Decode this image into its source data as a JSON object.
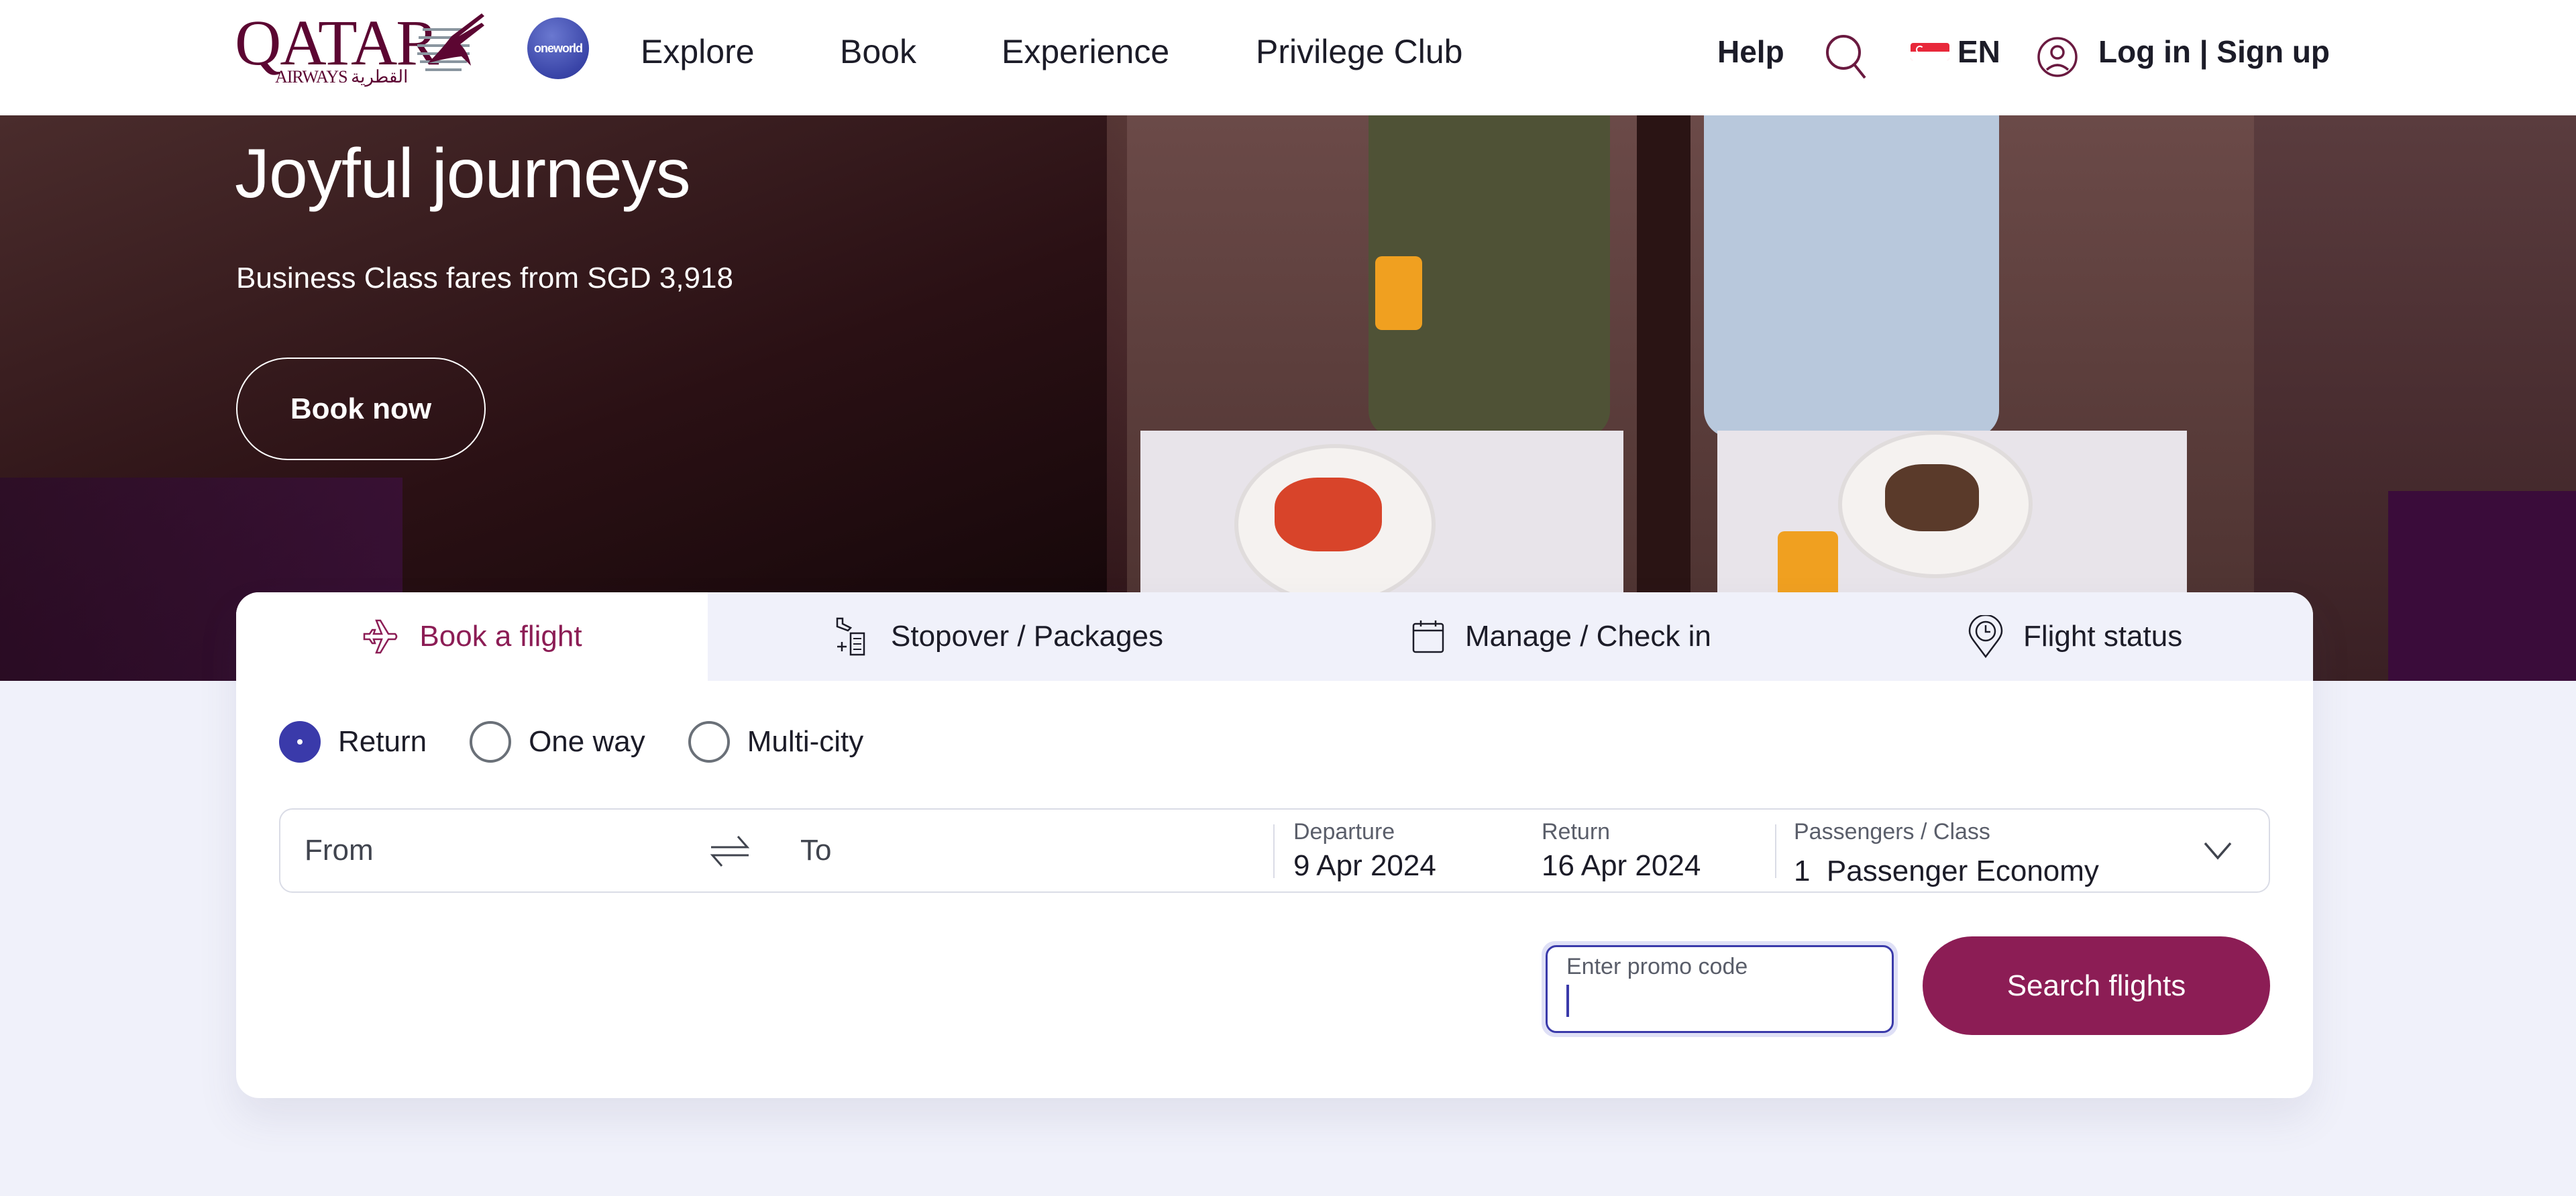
{
  "header": {
    "logo": {
      "wordmark": "QATAR",
      "subtitle": "AIRWAYS القطرية"
    },
    "alliance_badge": "oneworld",
    "nav": [
      {
        "label": "Explore"
      },
      {
        "label": "Book"
      },
      {
        "label": "Experience"
      },
      {
        "label": "Privilege Club"
      }
    ],
    "help": "Help",
    "search_icon": "search-icon",
    "language": {
      "flag": "singapore-flag",
      "code": "EN"
    },
    "account": "Log in | Sign up"
  },
  "hero": {
    "title": "Joyful journeys",
    "subtitle": "Business Class fares from SGD 3,918",
    "cta": "Book now"
  },
  "booking": {
    "tabs": [
      {
        "label": "Book a flight",
        "icon": "plane-icon",
        "active": true
      },
      {
        "label": "Stopover / Packages",
        "icon": "stopover-icon",
        "active": false
      },
      {
        "label": "Manage / Check in",
        "icon": "calendar-icon",
        "active": false
      },
      {
        "label": "Flight status",
        "icon": "location-clock-icon",
        "active": false
      }
    ],
    "trip_types": [
      {
        "label": "Return",
        "checked": true
      },
      {
        "label": "One way",
        "checked": false
      },
      {
        "label": "Multi-city",
        "checked": false
      }
    ],
    "from": {
      "placeholder": "From",
      "value": ""
    },
    "to": {
      "placeholder": "To",
      "value": ""
    },
    "departure": {
      "label": "Departure",
      "value": "9 Apr 2024"
    },
    "return": {
      "label": "Return",
      "value": "16 Apr 2024"
    },
    "passengers": {
      "label": "Passengers / Class",
      "value": "1  Passenger Economy"
    },
    "promo": {
      "label": "Enter promo code",
      "value": ""
    },
    "search_button": "Search flights"
  },
  "colors": {
    "brand": "#8c1d55",
    "logo": "#5c0632",
    "accent": "#3a3aaa",
    "page_bg": "#f0f1fa"
  }
}
